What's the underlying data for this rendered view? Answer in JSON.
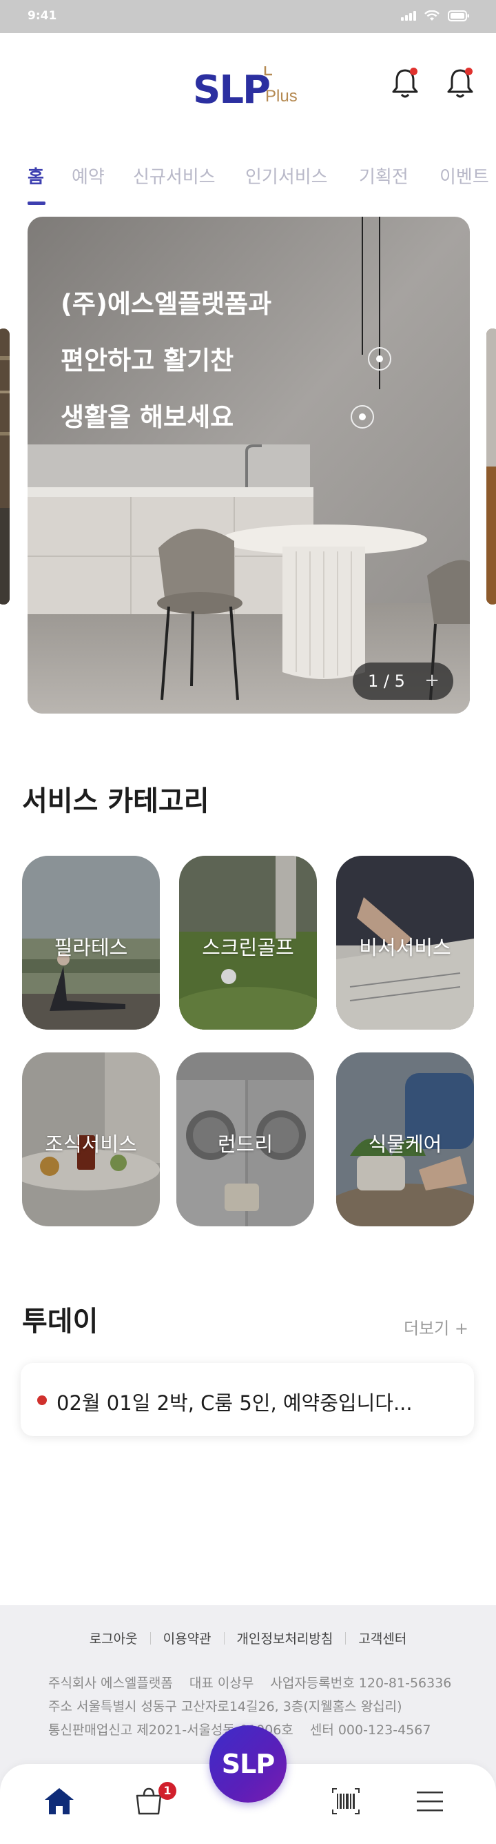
{
  "status_bar": {
    "time": "9:41"
  },
  "header": {
    "logo_main": "SLP",
    "logo_sub": "Plus",
    "icons": [
      "bell-icon",
      "bell-icon"
    ]
  },
  "tabs": [
    {
      "label": "홈",
      "active": true
    },
    {
      "label": "예약"
    },
    {
      "label": "신규서비스"
    },
    {
      "label": "인기서비스"
    },
    {
      "label": "기획전"
    },
    {
      "label": "이벤트"
    }
  ],
  "banner": {
    "lines": [
      "(주)에스엘플랫폼과",
      "편안하고 활기찬",
      "생활을 해보세요"
    ],
    "pager": "1 / 5",
    "pager_plus": "+"
  },
  "categories": {
    "title": "서비스 카테고리",
    "items": [
      {
        "label": "필라테스"
      },
      {
        "label": "스크린골프"
      },
      {
        "label": "비서서비스"
      },
      {
        "label": "조식서비스"
      },
      {
        "label": "런드리"
      },
      {
        "label": "식물케어"
      }
    ]
  },
  "today": {
    "title": "투데이",
    "more": "더보기 +",
    "item": "02월 01일 2박, C룸 5인, 예약중입니다..."
  },
  "footer": {
    "links": [
      "로그아웃",
      "이용약관",
      "개인정보처리방침",
      "고객센터"
    ],
    "company": "주식회사 에스엘플랫폼",
    "ceo": "대표 이상무",
    "biz_no": "사업자등록번호 120-81-56336",
    "address": "주소 서울특별시 성동구 고산자로14길26, 3층(지웰홈스 왕십리)",
    "ecommerce": "통신판매업신고 제2021-서울성동-01006호",
    "center": "센터 000-123-4567"
  },
  "bottom_nav": {
    "center_label": "SLP",
    "cart_count": "1",
    "items": [
      "home-icon",
      "cart-icon",
      "barcode-icon",
      "menu-icon"
    ]
  },
  "colors": {
    "brand": "#3d3fb0",
    "accent": "#b58a52",
    "badge": "#d11f2c"
  }
}
